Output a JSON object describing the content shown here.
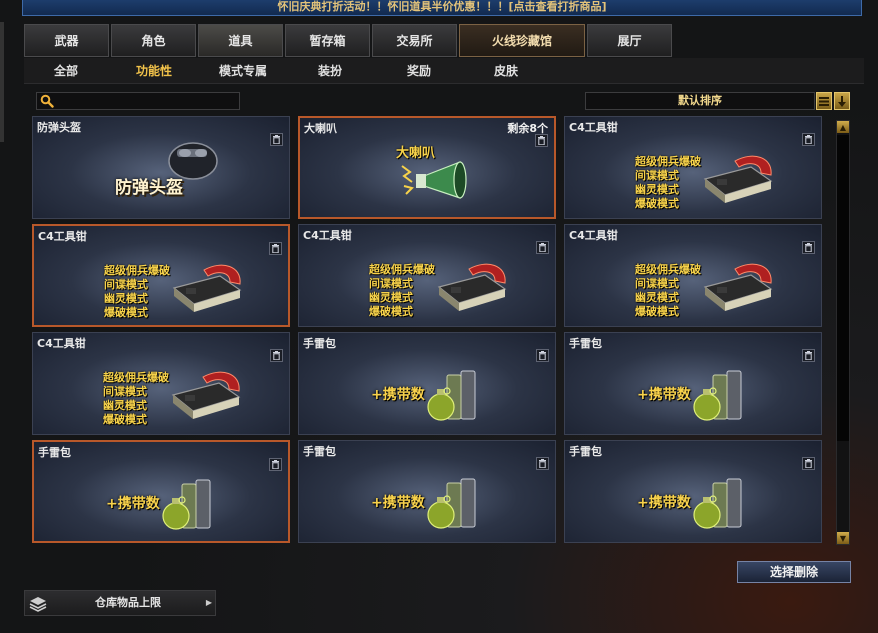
{
  "banner": "怀旧庆典打折活动！！怀旧道具半价优惠！！！[点击查看打折商品]",
  "main_tabs": [
    {
      "label": "武器"
    },
    {
      "label": "角色"
    },
    {
      "label": "道具"
    },
    {
      "label": "暂存箱"
    },
    {
      "label": "交易所"
    },
    {
      "label": "火线珍藏馆"
    },
    {
      "label": "展厅"
    }
  ],
  "sub_tabs": [
    {
      "label": "全部"
    },
    {
      "label": "功能性"
    },
    {
      "label": "模式专属"
    },
    {
      "label": "装扮"
    },
    {
      "label": "奖励"
    },
    {
      "label": "皮肤"
    }
  ],
  "active_sub_tab": "功能性",
  "search": {
    "value": "",
    "placeholder": ""
  },
  "sort": {
    "label": "默认排序"
  },
  "items": [
    {
      "name": "防弹头盔",
      "art_text": "防弹头盔",
      "type": "helmet"
    },
    {
      "name": "大喇叭",
      "remaining": "剩余8个",
      "art_text": "大喇叭",
      "type": "speaker"
    },
    {
      "name": "C4工具钳",
      "type": "c4"
    },
    {
      "name": "C4工具钳",
      "type": "c4"
    },
    {
      "name": "C4工具钳",
      "type": "c4"
    },
    {
      "name": "C4工具钳",
      "type": "c4"
    },
    {
      "name": "C4工具钳",
      "type": "c4"
    },
    {
      "name": "手雷包",
      "type": "grenade"
    },
    {
      "name": "手雷包",
      "type": "grenade"
    },
    {
      "name": "手雷包",
      "type": "grenade"
    },
    {
      "name": "手雷包",
      "type": "grenade"
    },
    {
      "name": "手雷包",
      "type": "grenade"
    }
  ],
  "c4_modes": [
    "超级佣兵爆破",
    "间谍模式",
    "幽灵模式",
    "爆破模式"
  ],
  "grenade_text": "+携带数",
  "delete_button": "选择删除",
  "storage_label": "仓库物品上限",
  "colors": {
    "accent": "#f1c24a",
    "selected_border": "#b8582a",
    "banner_bg": "#1d3d6c"
  }
}
